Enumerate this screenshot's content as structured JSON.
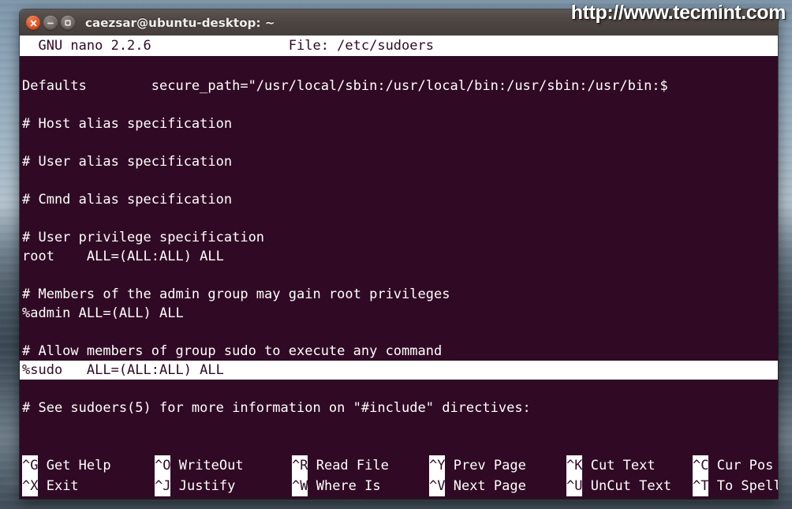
{
  "watermark": {
    "text": "http://www.tecmint.com"
  },
  "window": {
    "title": "caezsar@ubuntu-desktop: ~",
    "buttons": {
      "close": "close-button",
      "minimize": "minimize-button",
      "maximize": "maximize-button"
    },
    "colors": {
      "terminal_bg": "#300a24",
      "titlebar_bg": "#4c4542",
      "close_btn": "#e4562a",
      "text_fg": "#ffffff"
    }
  },
  "nano": {
    "titlebar": {
      "version": "  GNU nano 2.2.6",
      "file_label": "File: /etc/sudoers",
      "full": "  GNU nano 2.2.6                 File: /etc/sudoers"
    },
    "lines": [
      {
        "text": "",
        "highlight": false
      },
      {
        "text": "Defaults        secure_path=\"/usr/local/sbin:/usr/local/bin:/usr/sbin:/usr/bin:$",
        "highlight": false
      },
      {
        "text": "",
        "highlight": false
      },
      {
        "text": "# Host alias specification",
        "highlight": false
      },
      {
        "text": "",
        "highlight": false
      },
      {
        "text": "# User alias specification",
        "highlight": false
      },
      {
        "text": "",
        "highlight": false
      },
      {
        "text": "# Cmnd alias specification",
        "highlight": false
      },
      {
        "text": "",
        "highlight": false
      },
      {
        "text": "# User privilege specification",
        "highlight": false
      },
      {
        "text": "root    ALL=(ALL:ALL) ALL",
        "highlight": false
      },
      {
        "text": "",
        "highlight": false
      },
      {
        "text": "# Members of the admin group may gain root privileges",
        "highlight": false
      },
      {
        "text": "%admin ALL=(ALL) ALL",
        "highlight": false
      },
      {
        "text": "",
        "highlight": false
      },
      {
        "text": "# Allow members of group sudo to execute any command",
        "highlight": false
      },
      {
        "text": "%sudo   ALL=(ALL:ALL) ALL                                                       ",
        "highlight": true
      },
      {
        "text": "",
        "highlight": false
      },
      {
        "text": "# See sudoers(5) for more information on \"#include\" directives:",
        "highlight": false
      }
    ],
    "shortcuts": {
      "row1": [
        {
          "key": "^G",
          "label": " Get Help"
        },
        {
          "key": "^O",
          "label": " WriteOut"
        },
        {
          "key": "^R",
          "label": " Read File"
        },
        {
          "key": "^Y",
          "label": " Prev Page"
        },
        {
          "key": "^K",
          "label": " Cut Text"
        },
        {
          "key": "^C",
          "label": " Cur Pos"
        }
      ],
      "row2": [
        {
          "key": "^X",
          "label": " Exit"
        },
        {
          "key": "^J",
          "label": " Justify"
        },
        {
          "key": "^W",
          "label": " Where Is"
        },
        {
          "key": "^V",
          "label": " Next Page"
        },
        {
          "key": "^U",
          "label": " UnCut Text"
        },
        {
          "key": "^T",
          "label": " To Spell"
        }
      ]
    }
  }
}
